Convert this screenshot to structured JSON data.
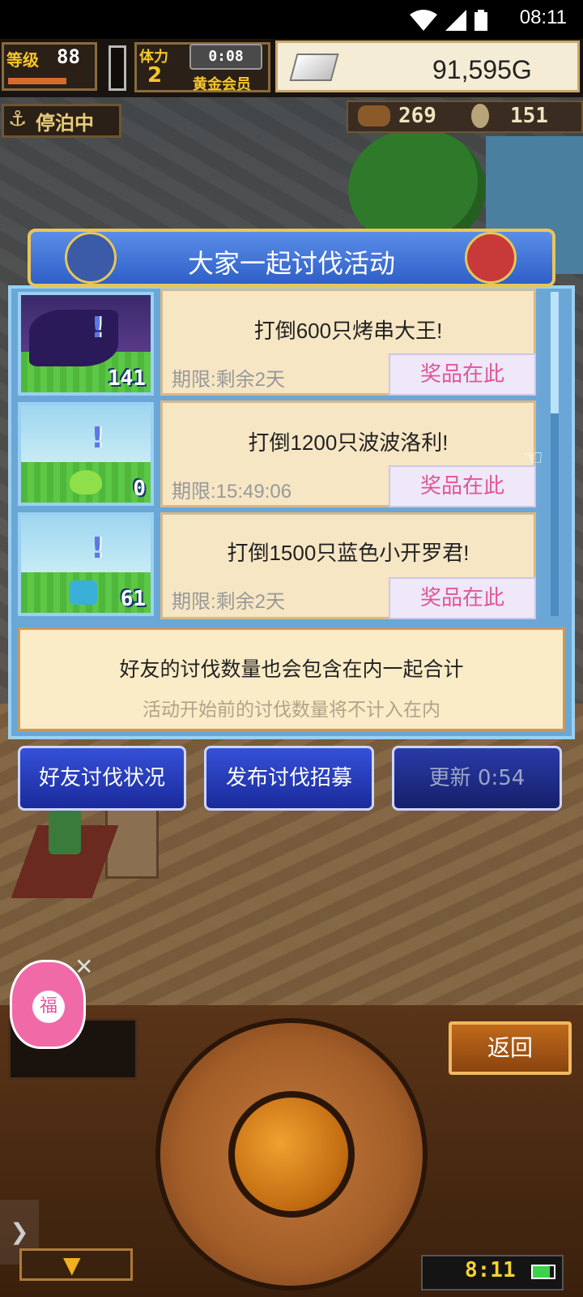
{
  "status_bar": {
    "time": "08:11",
    "wifi_icon": "wifi-icon",
    "signal_icon": "signal-icon",
    "battery_icon": "battery-icon"
  },
  "hud": {
    "level_label": "等级",
    "level_value": "88",
    "stamina_label": "体力",
    "stamina_value": "2",
    "timer": "0:08",
    "membership": "黄金会员",
    "gold": "91,595G",
    "dock_status": "停泊中",
    "resource_1": "269",
    "resource_2": "151"
  },
  "dialog": {
    "title": "大家一起讨伐活动",
    "events": [
      {
        "count": "141",
        "title": "打倒600只烤串大王!",
        "deadline": "期限:剩余2天",
        "prize_label": "奖品在此"
      },
      {
        "count": "0",
        "title": "打倒1200只波波洛利!",
        "deadline": "期限:15:49:06",
        "prize_label": "奖品在此"
      },
      {
        "count": "61",
        "title": "打倒1500只蓝色小开罗君!",
        "deadline": "期限:剩余2天",
        "prize_label": "奖品在此"
      }
    ],
    "info_main": "好友的讨伐数量也会包含在内一起合计",
    "info_sub": "活动开始前的讨伐数量将不计入在内",
    "buttons": {
      "friends_status": "好友讨伐状况",
      "post_recruit": "发布讨伐招募",
      "refresh": "更新 0:54"
    }
  },
  "bottom": {
    "fortune_label": "福",
    "back_label": "返回",
    "clock": "8:11"
  },
  "colors": {
    "dialog_blue": "#2f5fc8",
    "gold_border": "#e7c65a",
    "prize_pink": "#e0559a"
  }
}
